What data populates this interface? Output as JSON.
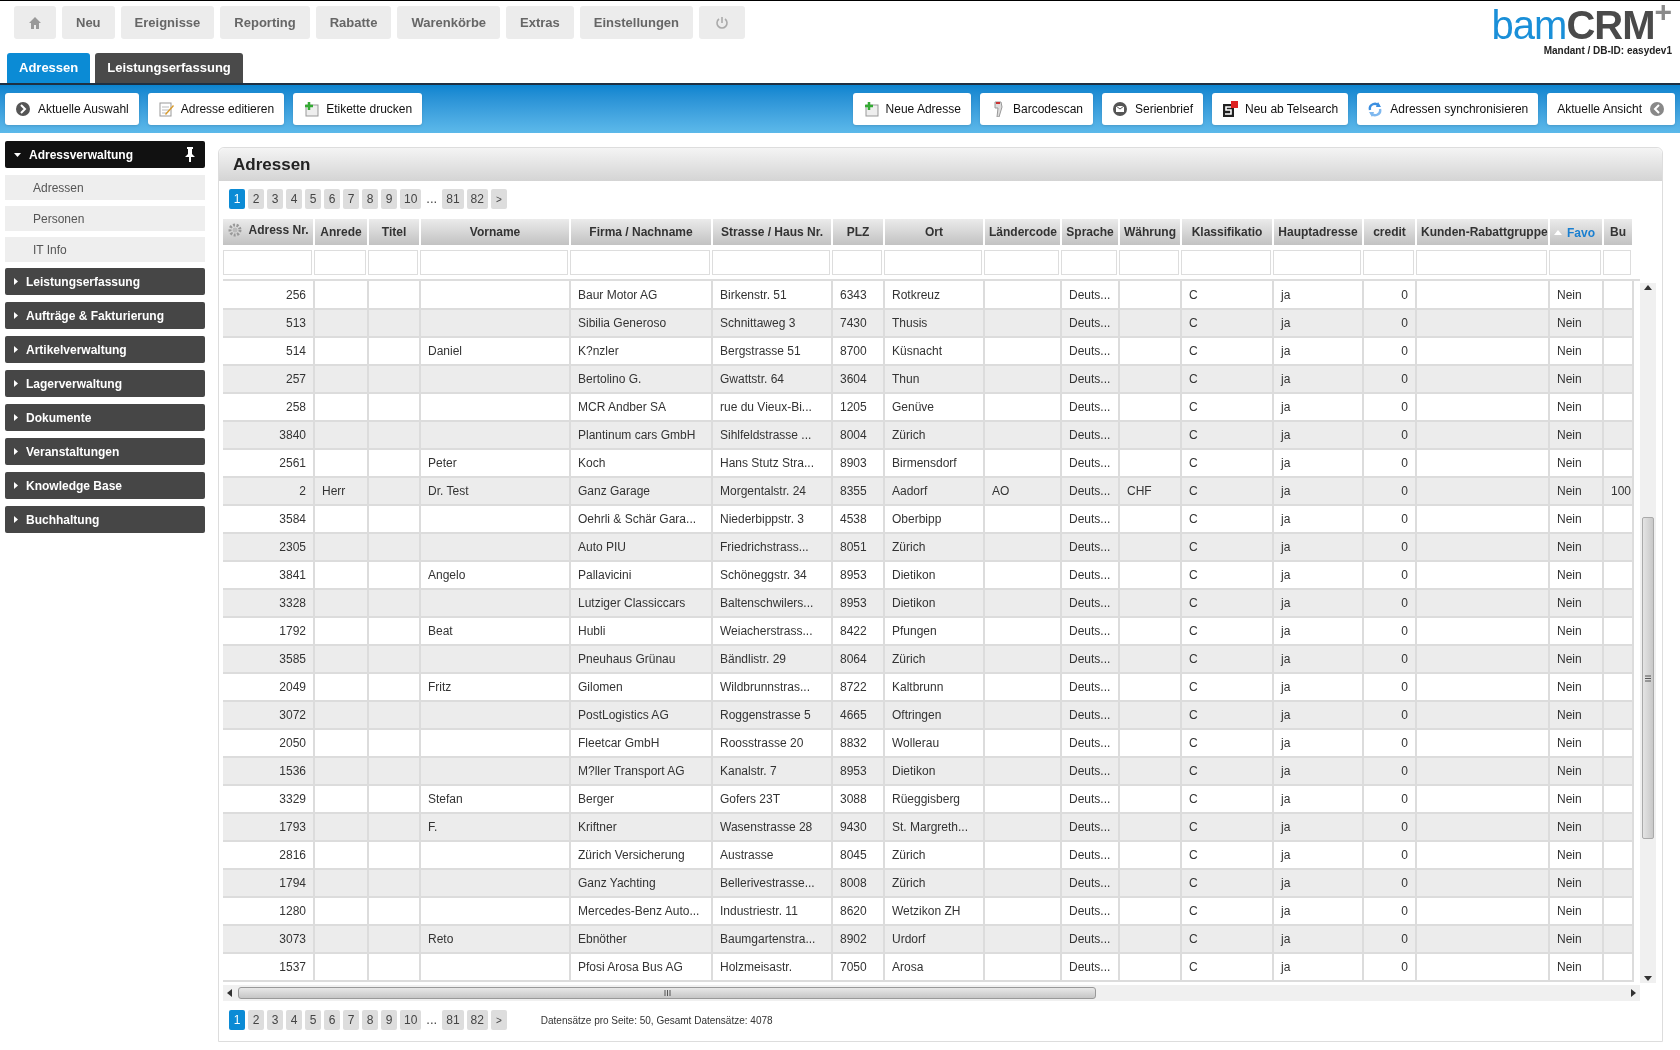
{
  "top_nav": [
    {
      "kind": "home"
    },
    {
      "kind": "text",
      "label": "Neu"
    },
    {
      "kind": "text",
      "label": "Ereignisse"
    },
    {
      "kind": "text",
      "label": "Reporting"
    },
    {
      "kind": "text",
      "label": "Rabatte"
    },
    {
      "kind": "text",
      "label": "Warenkörbe"
    },
    {
      "kind": "text",
      "label": "Extras"
    },
    {
      "kind": "text",
      "label": "Einstellungen"
    },
    {
      "kind": "power"
    }
  ],
  "logo": {
    "text_a": "bam",
    "text_b": "CRM",
    "plus": "+",
    "subtitle": "Mandant / DB-ID: easydev1"
  },
  "tabs": [
    {
      "label": "Adressen",
      "selected": true
    },
    {
      "label": "Leistungserfassung",
      "selected": false
    }
  ],
  "toolbar_left": [
    {
      "label": "Aktuelle Auswahl"
    },
    {
      "label": "Adresse editieren"
    },
    {
      "label": "Etikette drucken"
    }
  ],
  "toolbar_right": [
    {
      "label": "Neue Adresse"
    },
    {
      "label": "Barcodescan"
    },
    {
      "label": "Serienbrief"
    },
    {
      "label": "Neu ab Telsearch"
    },
    {
      "label": "Adressen synchronisieren"
    },
    {
      "label": "Aktuelle Ansicht"
    }
  ],
  "sidebar": [
    {
      "label": "Adressverwaltung",
      "expanded": true,
      "children": [
        {
          "label": "Adressen"
        },
        {
          "label": "Personen"
        },
        {
          "label": "IT Info"
        }
      ]
    },
    {
      "label": "Leistungserfassung",
      "expanded": false
    },
    {
      "label": "Aufträge & Fakturierung",
      "expanded": false
    },
    {
      "label": "Artikelverwaltung",
      "expanded": false
    },
    {
      "label": "Lagerverwaltung",
      "expanded": false
    },
    {
      "label": "Dokumente",
      "expanded": false
    },
    {
      "label": "Veranstaltungen",
      "expanded": false
    },
    {
      "label": "Knowledge Base",
      "expanded": false
    },
    {
      "label": "Buchhaltung",
      "expanded": false
    }
  ],
  "panel": {
    "title": "Adressen",
    "pagination_top": [
      {
        "kind": "page",
        "label": "1",
        "selected": true
      },
      {
        "kind": "page",
        "label": "2",
        "selected": false
      },
      {
        "kind": "page",
        "label": "3",
        "selected": false
      },
      {
        "kind": "page",
        "label": "4",
        "selected": false
      },
      {
        "kind": "page",
        "label": "5",
        "selected": false
      },
      {
        "kind": "page",
        "label": "6",
        "selected": false
      },
      {
        "kind": "page",
        "label": "7",
        "selected": false
      },
      {
        "kind": "page",
        "label": "8",
        "selected": false
      },
      {
        "kind": "page",
        "label": "9",
        "selected": false
      },
      {
        "kind": "page",
        "label": "10",
        "selected": false
      },
      {
        "kind": "gap",
        "label": "..."
      },
      {
        "kind": "page",
        "label": "81",
        "selected": false
      },
      {
        "kind": "page",
        "label": "82",
        "selected": false
      },
      {
        "kind": "next",
        "label": ">"
      }
    ],
    "columns": [
      {
        "label": "Adress Nr.",
        "sorted": false
      },
      {
        "label": "Anrede",
        "sorted": false
      },
      {
        "label": "Titel",
        "sorted": false
      },
      {
        "label": "Vorname",
        "sorted": false
      },
      {
        "label": "Firma / Nachname",
        "sorted": false
      },
      {
        "label": "Strasse / Haus Nr.",
        "sorted": false
      },
      {
        "label": "PLZ",
        "sorted": false
      },
      {
        "label": "Ort",
        "sorted": false
      },
      {
        "label": "Ländercode",
        "sorted": false
      },
      {
        "label": "Sprache",
        "sorted": false
      },
      {
        "label": "Währung",
        "sorted": false
      },
      {
        "label": "Klassifikatio",
        "sorted": false
      },
      {
        "label": "Hauptadresse",
        "sorted": false
      },
      {
        "label": "credit",
        "sorted": false
      },
      {
        "label": "Kunden-Rabattgruppe",
        "sorted": false
      },
      {
        "label": "Favo",
        "sorted": true
      },
      {
        "label": "Bu",
        "sorted": false
      }
    ],
    "rows": [
      [
        "256",
        null,
        null,
        null,
        "Baur Motor AG",
        "Birkenstr. 51",
        "6343",
        "Rotkreuz",
        null,
        "Deuts...",
        null,
        "C",
        "ja",
        "0",
        null,
        "Nein",
        null
      ],
      [
        "513",
        null,
        null,
        null,
        "Sibilia Generoso",
        "Schnittaweg 3",
        "7430",
        "Thusis",
        null,
        "Deuts...",
        null,
        "C",
        "ja",
        "0",
        null,
        "Nein",
        null
      ],
      [
        "514",
        null,
        null,
        "Daniel",
        "K?nzler",
        "Bergstrasse 51",
        "8700",
        "Küsnacht",
        null,
        "Deuts...",
        null,
        "C",
        "ja",
        "0",
        null,
        "Nein",
        null
      ],
      [
        "257",
        null,
        null,
        null,
        "Bertolino G.",
        "Gwattstr. 64",
        "3604",
        "Thun",
        null,
        "Deuts...",
        null,
        "C",
        "ja",
        "0",
        null,
        "Nein",
        null
      ],
      [
        "258",
        null,
        null,
        null,
        "MCR Andber SA",
        "rue du Vieux-Bi...",
        "1205",
        "Genüve",
        null,
        "Deuts...",
        null,
        "C",
        "ja",
        "0",
        null,
        "Nein",
        null
      ],
      [
        "3840",
        null,
        null,
        null,
        "Plantinum cars GmbH",
        "Sihlfeldstrasse ...",
        "8004",
        "Zürich",
        null,
        "Deuts...",
        null,
        "C",
        "ja",
        "0",
        null,
        "Nein",
        null
      ],
      [
        "2561",
        null,
        null,
        "Peter",
        "Koch",
        "Hans Stutz Stra...",
        "8903",
        "Birmensdorf",
        null,
        "Deuts...",
        null,
        "C",
        "ja",
        "0",
        null,
        "Nein",
        null
      ],
      [
        "2",
        "Herr",
        null,
        "Dr. Test",
        "Ganz Garage",
        "Morgentalstr. 24",
        "8355",
        "Aadorf",
        "AO",
        "Deuts...",
        "CHF",
        "C",
        "ja",
        "0",
        null,
        "Nein",
        "100"
      ],
      [
        "3584",
        null,
        null,
        null,
        "Oehrli & Schär Gara...",
        "Niederbippstr. 3",
        "4538",
        "Oberbipp",
        null,
        "Deuts...",
        null,
        "C",
        "ja",
        "0",
        null,
        "Nein",
        null
      ],
      [
        "2305",
        null,
        null,
        null,
        "Auto PIU",
        "Friedrichstrass...",
        "8051",
        "Zürich",
        null,
        "Deuts...",
        null,
        "C",
        "ja",
        "0",
        null,
        "Nein",
        null
      ],
      [
        "3841",
        null,
        null,
        "Angelo",
        "Pallavicini",
        "Schöneggstr. 34",
        "8953",
        "Dietikon",
        null,
        "Deuts...",
        null,
        "C",
        "ja",
        "0",
        null,
        "Nein",
        null
      ],
      [
        "3328",
        null,
        null,
        null,
        "Lutziger Classiccars",
        "Baltenschwilers...",
        "8953",
        "Dietikon",
        null,
        "Deuts...",
        null,
        "C",
        "ja",
        "0",
        null,
        "Nein",
        null
      ],
      [
        "1792",
        null,
        null,
        "Beat",
        "Hubli",
        "Weiacherstrass...",
        "8422",
        "Pfungen",
        null,
        "Deuts...",
        null,
        "C",
        "ja",
        "0",
        null,
        "Nein",
        null
      ],
      [
        "3585",
        null,
        null,
        null,
        "Pneuhaus Grünau",
        "Bändlistr. 29",
        "8064",
        "Zürich",
        null,
        "Deuts...",
        null,
        "C",
        "ja",
        "0",
        null,
        "Nein",
        null
      ],
      [
        "2049",
        null,
        null,
        "Fritz",
        "Gilomen",
        "Wildbrunnstras...",
        "8722",
        "Kaltbrunn",
        null,
        "Deuts...",
        null,
        "C",
        "ja",
        "0",
        null,
        "Nein",
        null
      ],
      [
        "3072",
        null,
        null,
        null,
        "PostLogistics AG",
        "Roggenstrasse 5",
        "4665",
        "Oftringen",
        null,
        "Deuts...",
        null,
        "C",
        "ja",
        "0",
        null,
        "Nein",
        null
      ],
      [
        "2050",
        null,
        null,
        null,
        "Fleetcar GmbH",
        "Roosstrasse 20",
        "8832",
        "Wollerau",
        null,
        "Deuts...",
        null,
        "C",
        "ja",
        "0",
        null,
        "Nein",
        null
      ],
      [
        "1536",
        null,
        null,
        null,
        "M?ller Transport AG",
        "Kanalstr. 7",
        "8953",
        "Dietikon",
        null,
        "Deuts...",
        null,
        "C",
        "ja",
        "0",
        null,
        "Nein",
        null
      ],
      [
        "3329",
        null,
        null,
        "Stefan",
        "Berger",
        "Gofers 23T",
        "3088",
        "Rüeggisberg",
        null,
        "Deuts...",
        null,
        "C",
        "ja",
        "0",
        null,
        "Nein",
        null
      ],
      [
        "1793",
        null,
        null,
        "F.",
        "Kriftner",
        "Wasenstrasse 28",
        "9430",
        "St. Margreth...",
        null,
        "Deuts...",
        null,
        "C",
        "ja",
        "0",
        null,
        "Nein",
        null
      ],
      [
        "2816",
        null,
        null,
        null,
        "Zürich Versicherung",
        "Austrasse",
        "8045",
        "Zürich",
        null,
        "Deuts...",
        null,
        "C",
        "ja",
        "0",
        null,
        "Nein",
        null
      ],
      [
        "1794",
        null,
        null,
        null,
        "Ganz Yachting",
        "Bellerivestrasse...",
        "8008",
        "Zürich",
        null,
        "Deuts...",
        null,
        "C",
        "ja",
        "0",
        null,
        "Nein",
        null
      ],
      [
        "1280",
        null,
        null,
        null,
        "Mercedes-Benz Auto...",
        "Industriestr. 11",
        "8620",
        "Wetzikon ZH",
        null,
        "Deuts...",
        null,
        "C",
        "ja",
        "0",
        null,
        "Nein",
        null
      ],
      [
        "3073",
        null,
        null,
        "Reto",
        "Ebnöther",
        "Baumgartenstra...",
        "8902",
        "Urdorf",
        null,
        "Deuts...",
        null,
        "C",
        "ja",
        "0",
        null,
        "Nein",
        null
      ],
      [
        "1537",
        null,
        null,
        null,
        "Pfosi Arosa Bus AG",
        "Holzmeisastr.",
        "7050",
        "Arosa",
        null,
        "Deuts...",
        null,
        "C",
        "ja",
        "0",
        null,
        "Nein",
        null
      ]
    ],
    "pagination_bottom": [
      {
        "kind": "page",
        "label": "1",
        "selected": true
      },
      {
        "kind": "page",
        "label": "2",
        "selected": false
      },
      {
        "kind": "page",
        "label": "3",
        "selected": false
      },
      {
        "kind": "page",
        "label": "4",
        "selected": false
      },
      {
        "kind": "page",
        "label": "5",
        "selected": false
      },
      {
        "kind": "page",
        "label": "6",
        "selected": false
      },
      {
        "kind": "page",
        "label": "7",
        "selected": false
      },
      {
        "kind": "page",
        "label": "8",
        "selected": false
      },
      {
        "kind": "page",
        "label": "9",
        "selected": false
      },
      {
        "kind": "page",
        "label": "10",
        "selected": false
      },
      {
        "kind": "gap",
        "label": "..."
      },
      {
        "kind": "page",
        "label": "81",
        "selected": false
      },
      {
        "kind": "page",
        "label": "82",
        "selected": false
      },
      {
        "kind": "next",
        "label": ">"
      }
    ],
    "records_info": "Datensätze pro Seite: 50, Gesamt Datensätze: 4078"
  }
}
